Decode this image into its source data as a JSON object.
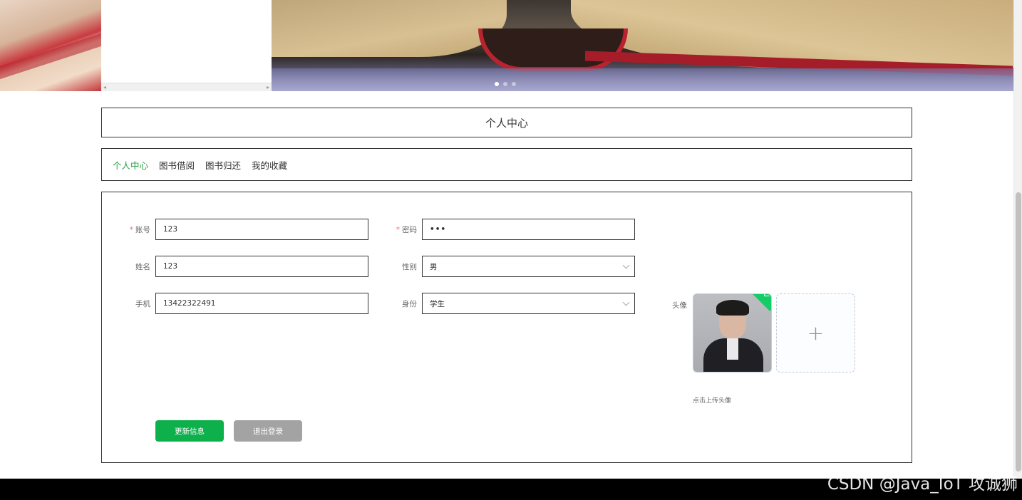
{
  "banner": {
    "active_slide": 1,
    "slide_count": 3
  },
  "page_title": "个人中心",
  "tabs": [
    {
      "label": "个人中心",
      "active": true
    },
    {
      "label": "图书借阅",
      "active": false
    },
    {
      "label": "图书归还",
      "active": false
    },
    {
      "label": "我的收藏",
      "active": false
    }
  ],
  "form": {
    "account": {
      "label": "账号",
      "value": "123",
      "required": true
    },
    "password": {
      "label": "密码",
      "value": "•••",
      "required": true
    },
    "name": {
      "label": "姓名",
      "value": "123"
    },
    "gender": {
      "label": "性别",
      "value": "男"
    },
    "phone": {
      "label": "手机",
      "value": "13422322491"
    },
    "role": {
      "label": "身份",
      "value": "学生"
    },
    "avatar": {
      "label": "头像",
      "upload_tip": "点击上传头像"
    }
  },
  "buttons": {
    "update": "更新信息",
    "logout": "退出登录"
  },
  "watermark": "CSDN @Java_IoT 攻诚狮",
  "colors": {
    "accent": "#2aa048",
    "update_button": "#0db04b",
    "logout_button": "#a3a3a3",
    "required": "#f56c6c"
  }
}
